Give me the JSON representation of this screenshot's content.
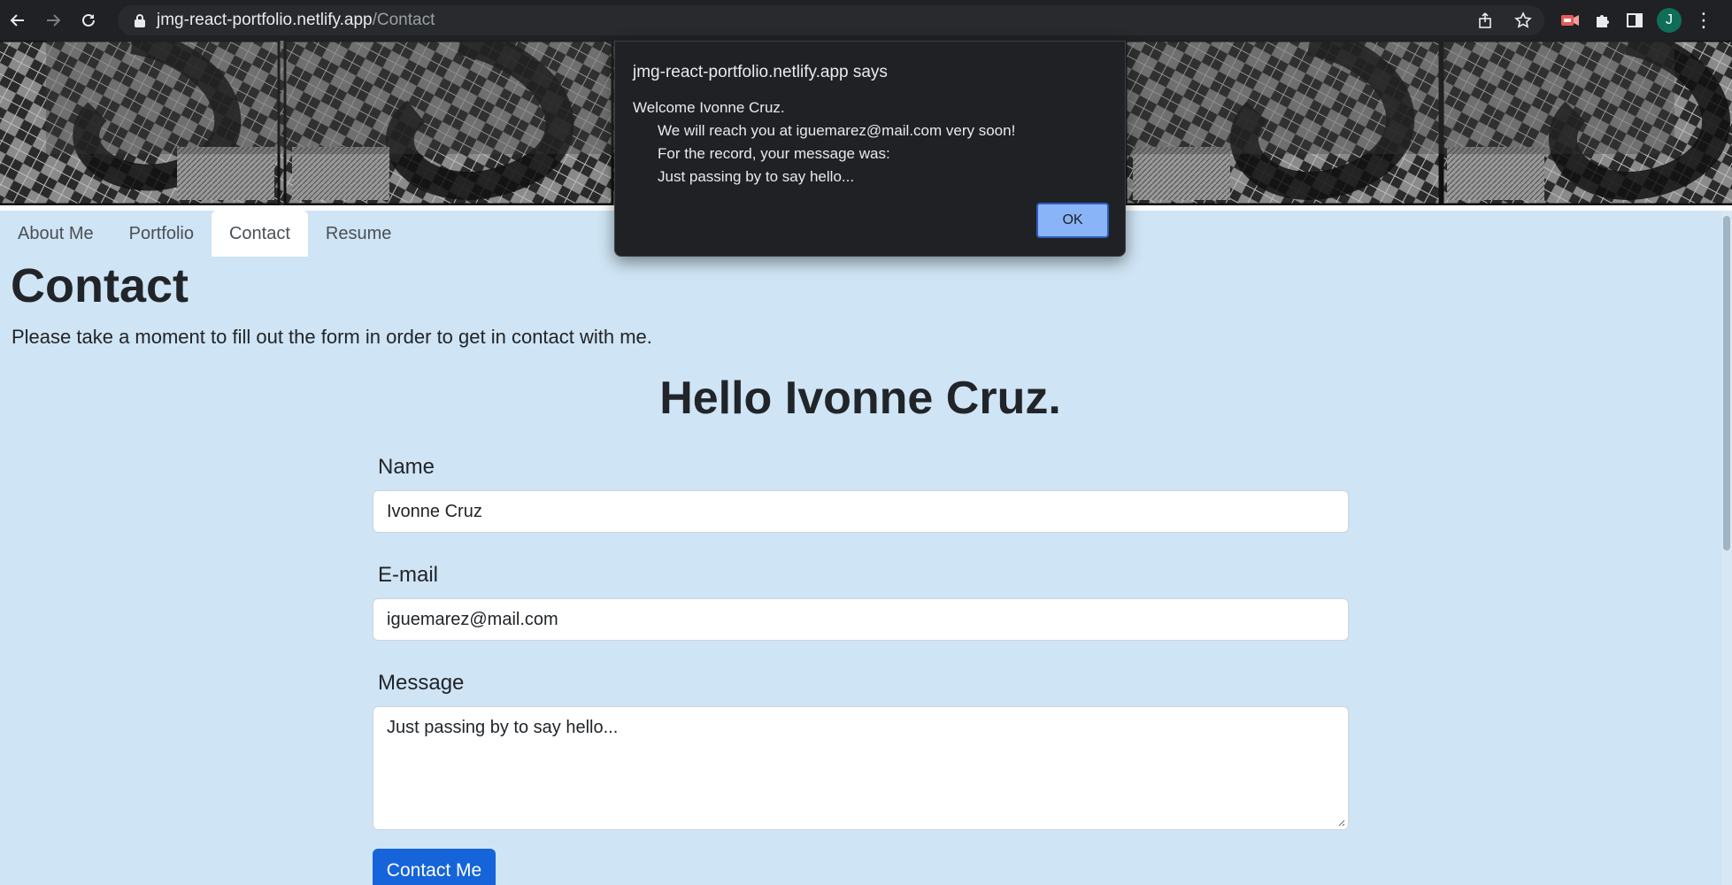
{
  "browser": {
    "url_host": "jmg-react-portfolio.netlify.app",
    "url_path": "/Contact",
    "profile_initial": "J"
  },
  "nav": {
    "tabs": [
      {
        "label": "About Me",
        "active": false
      },
      {
        "label": "Portfolio",
        "active": false
      },
      {
        "label": "Contact",
        "active": true
      },
      {
        "label": "Resume",
        "active": false
      }
    ]
  },
  "page": {
    "title": "Contact",
    "intro": "Please take a moment to fill out the form in order to get in contact with me.",
    "greeting": "Hello Ivonne Cruz."
  },
  "form": {
    "name_label": "Name",
    "name_value": "Ivonne Cruz",
    "email_label": "E-mail",
    "email_value": "iguemarez@mail.com",
    "message_label": "Message",
    "message_value": "Just passing by to say hello...",
    "submit_label": "Contact Me"
  },
  "dialog": {
    "title": "jmg-react-portfolio.netlify.app says",
    "lines": [
      "Welcome Ivonne Cruz.",
      "We will reach you at iguemarez@mail.com very soon!",
      "For the record, your message was:",
      "Just passing by to say hello..."
    ],
    "ok_label": "OK"
  },
  "colors": {
    "page_bg": "#cfe4f4",
    "primary_button": "#1664d9",
    "dialog_bg": "#202124",
    "dialog_ok": "#8ab4f8",
    "chrome_bg": "#202124"
  },
  "icons": [
    "back-arrow-icon",
    "forward-arrow-icon",
    "reload-icon",
    "lock-icon",
    "share-icon",
    "star-icon",
    "extension-icon",
    "puzzle-icon",
    "side-panel-icon",
    "menu-icon"
  ]
}
